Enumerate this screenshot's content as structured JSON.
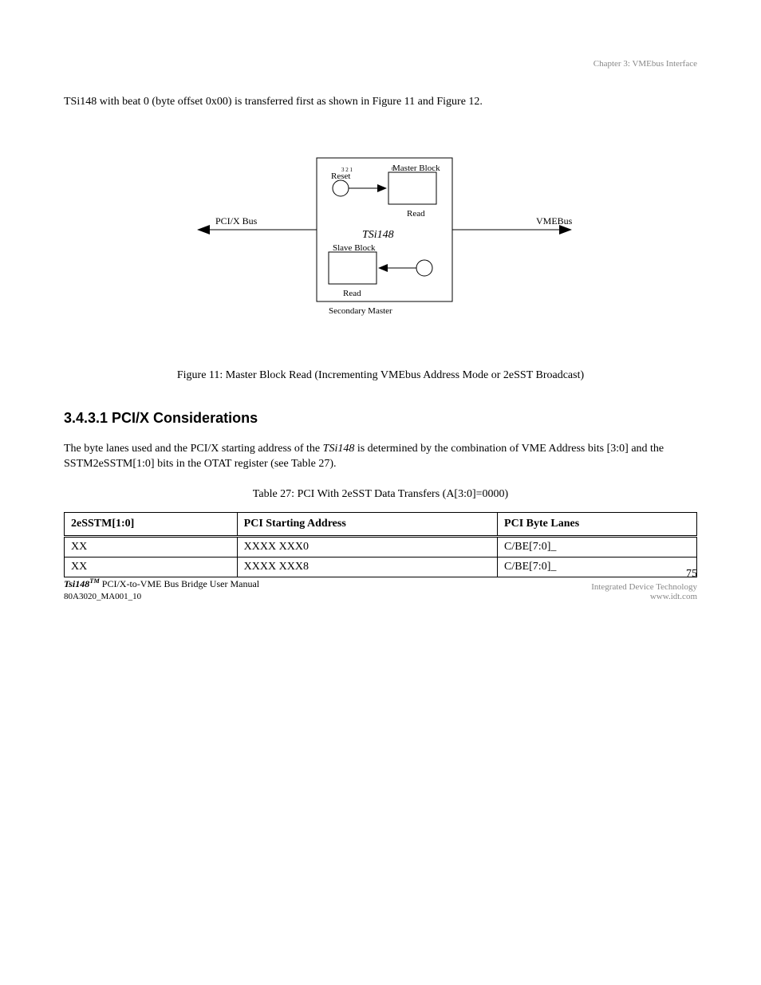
{
  "header": {
    "chapter": "Chapter 3: VMEbus Interface"
  },
  "intro_paragraph": "TSi148 with beat 0 (byte offset 0x00) is transferred first as shown in Figure 11 and Figure 12.",
  "figure": {
    "labels": {
      "pci_bus": "PCI/X Bus",
      "vmebus": "VMEBus",
      "master_block": "Master Block  Read",
      "reset": "Reset",
      "center_label": "TSi148",
      "slave_block": "Slave Block  Read",
      "secondary_master": "Secondary Master"
    },
    "caption": "Figure 11: Master Block Read (Incrementing VMEbus Address Mode or 2eSST Broadcast)"
  },
  "section": {
    "heading": "3.4.3.1 PCI/X Considerations",
    "body_prefix": "The byte lanes used and the PCI/X starting address of the ",
    "body_italic": "TSi148",
    "body_suffix": " is determined by the combination of VME Address bits [3:0] and the SSTM2eSSTM[1:0] bits in the OTAT register (see Table 27)."
  },
  "table": {
    "caption": "Table 27: PCI With 2eSST Data Transfers (A[3:0]=0000)",
    "headers": [
      "2eSSTM[1:0]",
      "PCI Starting Address",
      "PCI Byte Lanes"
    ],
    "rows": [
      [
        "XX",
        "XXXX XXX0",
        "C/BE[7:0]_"
      ],
      [
        "XX",
        "XXXX XXX8",
        "C/BE[7:0]_"
      ]
    ]
  },
  "footer": {
    "left_prefix": "Tsi148",
    "left_suffix": " PCI/X-to-VME Bus Bridge User Manual",
    "right": "Integrated Device Technology",
    "page_number": "75",
    "doc_id": "80A3020_MA001_10"
  }
}
